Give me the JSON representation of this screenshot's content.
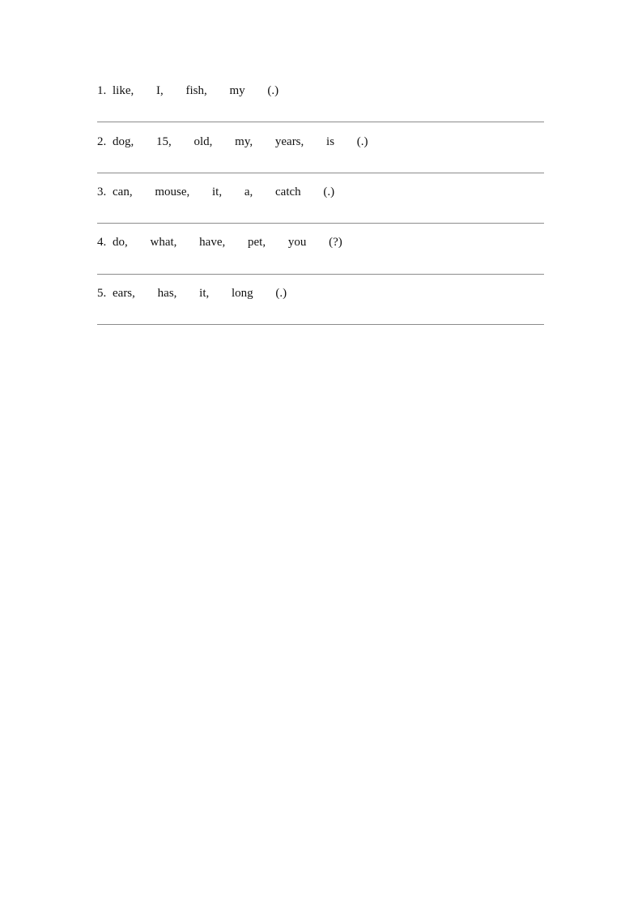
{
  "questions": [
    {
      "number": "1.",
      "words": [
        "like,",
        "I,",
        "fish,",
        "my"
      ],
      "punctuation": "(.)",
      "answer": ""
    },
    {
      "number": "2.",
      "words": [
        "dog,",
        "15,",
        "old,",
        "my,",
        "years,",
        "is"
      ],
      "punctuation": "(.)",
      "answer": ""
    },
    {
      "number": "3.",
      "words": [
        "can,",
        "mouse,",
        "it,",
        "a,",
        "catch"
      ],
      "punctuation": "(.)",
      "answer": ""
    },
    {
      "number": "4.",
      "words": [
        "do,",
        "what,",
        "have,",
        "pet,",
        "you"
      ],
      "punctuation": "(?)",
      "answer": ""
    },
    {
      "number": "5.",
      "words": [
        "ears,",
        "has,",
        "it,",
        "long"
      ],
      "punctuation": "(.)",
      "answer": ""
    }
  ]
}
